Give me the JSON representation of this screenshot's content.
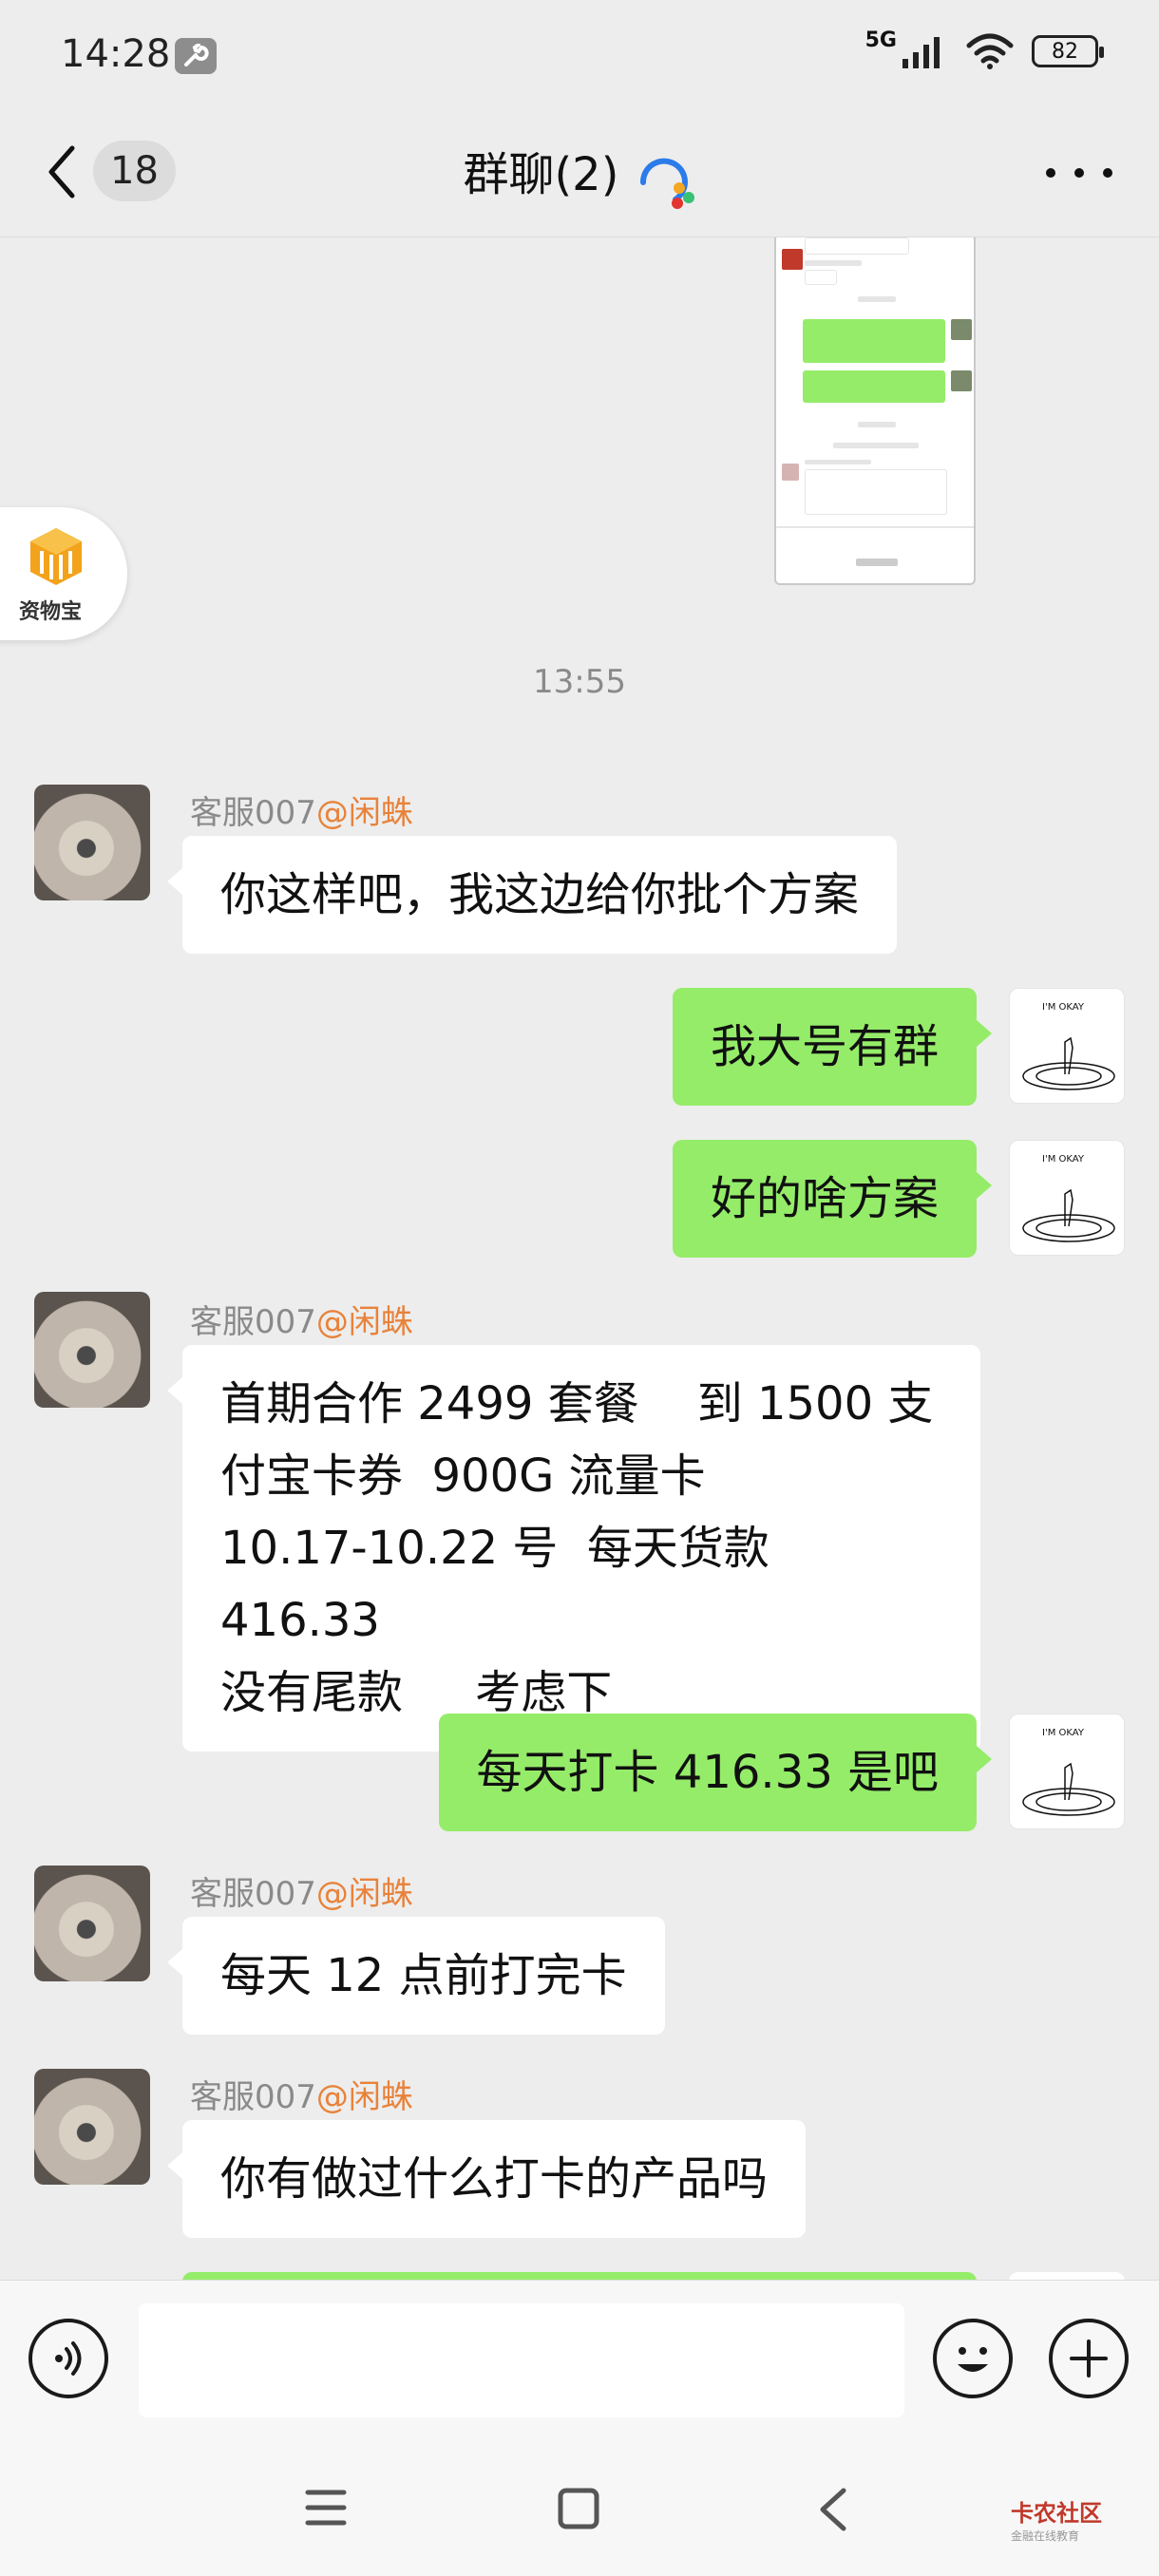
{
  "status_bar": {
    "time": "14:28",
    "network": "5G",
    "battery": "82"
  },
  "header": {
    "unread_count": "18",
    "title": "群聊(2)"
  },
  "chat": {
    "timestamp": "13:55",
    "float_badge_label": "资物宝",
    "messages": [
      {
        "sender_name": "客服007",
        "sender_tag": "@闲蛛",
        "text": "你这样吧，我这边给你批个方案"
      },
      {
        "text": "我大号有群"
      },
      {
        "text": "好的啥方案"
      },
      {
        "sender_name": "客服007",
        "sender_tag": "@闲蛛",
        "text": "首期合作 2499 套餐    到 1500 支\n付宝卡券  900G 流量卡\n10.17-10.22 号  每天货款 416.33\n没有尾款     考虑下"
      },
      {
        "text": "每天打卡 416.33 是吧"
      },
      {
        "sender_name": "客服007",
        "sender_tag": "@闲蛛",
        "text": "每天 12 点前打完卡"
      },
      {
        "sender_name": "客服007",
        "sender_tag": "@闲蛛",
        "text": "你有做过什么打卡的产品吗"
      }
    ]
  },
  "input": {
    "placeholder": ""
  },
  "watermark": {
    "title": "卡农社区",
    "subtitle": "金融在线教育"
  }
}
